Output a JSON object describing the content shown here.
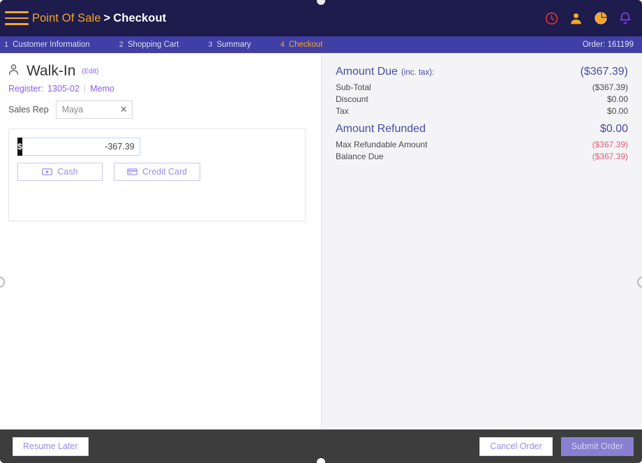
{
  "window": {
    "notch_top": "camera-notch",
    "notch_bottom": "home-indicator"
  },
  "header": {
    "menu_icon": "hamburger-menu-icon",
    "brand": "Point Of Sale",
    "separator": ">",
    "page": "Checkout",
    "icons": [
      {
        "name": "clock-icon",
        "color": "#e03131"
      },
      {
        "name": "user-icon",
        "color": "#f5a623"
      },
      {
        "name": "pie-chart-icon",
        "color": "#f5a623"
      },
      {
        "name": "bell-icon",
        "color": "#7b3fe4"
      }
    ],
    "bg_color": "#1e1b4d"
  },
  "steps": {
    "bg_color": "#3f3fa5",
    "active_color": "#f5a623",
    "items": [
      {
        "num": "1",
        "label": "Customer Information",
        "active": false
      },
      {
        "num": "2",
        "label": "Shopping Cart",
        "active": false
      },
      {
        "num": "3",
        "label": "Summary",
        "active": false
      },
      {
        "num": "4",
        "label": "Checkout",
        "active": true
      }
    ],
    "order_label": "Order: 161199"
  },
  "customer": {
    "icon": "person-icon",
    "name": "Walk-In",
    "edit_link": "(Edit)",
    "register_label": "Register:",
    "register_value": "1305-02",
    "divider": "|",
    "memo_link": "Memo",
    "sales_rep_label": "Sales Rep",
    "sales_rep_value": "Maya",
    "sales_rep_placeholder": "Sales Rep",
    "clear_icon": "close-icon"
  },
  "payment": {
    "currency_symbol": "$",
    "amount_value": "-367.39",
    "amount_placeholder": "0.00",
    "buttons": [
      {
        "label": "Cash",
        "icon": "banknote-icon"
      },
      {
        "label": "Credit Card",
        "icon": "credit-card-icon"
      }
    ],
    "accent_color": "#9b8bf0"
  },
  "summary": {
    "amount_due_title": "Amount Due",
    "amount_due_sub": "(inc. tax):",
    "amount_due_value": "($367.39)",
    "lines_top": [
      {
        "label": "Sub-Total",
        "value": "($367.39)",
        "negative": false
      },
      {
        "label": "Discount",
        "value": "$0.00",
        "negative": false
      },
      {
        "label": "Tax",
        "value": "$0.00",
        "negative": false
      }
    ],
    "amount_refunded_title": "Amount Refunded",
    "amount_refunded_value": "$0.00",
    "lines_bottom": [
      {
        "label": "Max Refundable Amount",
        "value": "($367.39)",
        "negative": true
      },
      {
        "label": "Balance Due",
        "value": "($367.39)",
        "negative": true
      }
    ],
    "heading_color": "#4b4ba8",
    "negative_color": "#e05c7a"
  },
  "footer": {
    "bg_color": "#3d3d3d",
    "resume_later": "Resume Later",
    "cancel_order": "Cancel Order",
    "submit_order": "Submit Order"
  }
}
